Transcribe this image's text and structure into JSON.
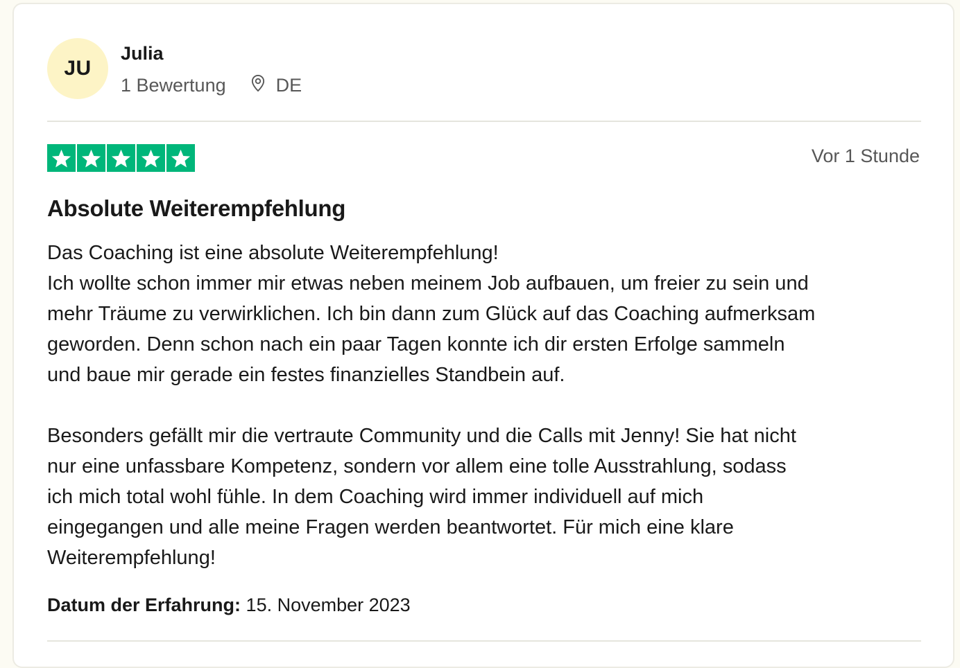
{
  "consumer": {
    "initials": "JU",
    "name": "Julia",
    "review_count": "1 Bewertung",
    "country": "DE",
    "avatar_bg": "#fdf4c6"
  },
  "review": {
    "rating": 5,
    "star_color": "#00b67a",
    "posted": "Vor 1 Stunde",
    "title": "Absolute Weiterempfehlung",
    "paragraph1_lines": [
      "Das Coaching ist eine absolute Weiterempfehlung!",
      "Ich wollte schon immer mir etwas neben meinem Job aufbauen, um freier zu sein und",
      "mehr Träume zu verwirklichen. Ich bin dann zum Glück auf das Coaching aufmerksam",
      "geworden. Denn schon nach ein paar Tagen konnte ich dir ersten Erfolge sammeln",
      "und baue mir gerade ein festes finanzielles Standbein auf."
    ],
    "paragraph2_lines": [
      "Besonders gefällt mir die vertraute Community und die Calls mit Jenny! Sie hat nicht",
      "nur eine unfassbare Kompetenz, sondern vor allem eine tolle Ausstrahlung, sodass",
      "ich mich total wohl fühle. In dem Coaching wird immer individuell auf mich",
      "eingegangen und alle meine Fragen werden beantwortet. Für mich eine klare",
      "Weiterempfehlung!"
    ],
    "experience_label": "Datum der Erfahrung:",
    "experience_date": "15. November 2023"
  },
  "icons": {
    "location": "location-pin-icon",
    "star": "star-icon"
  }
}
